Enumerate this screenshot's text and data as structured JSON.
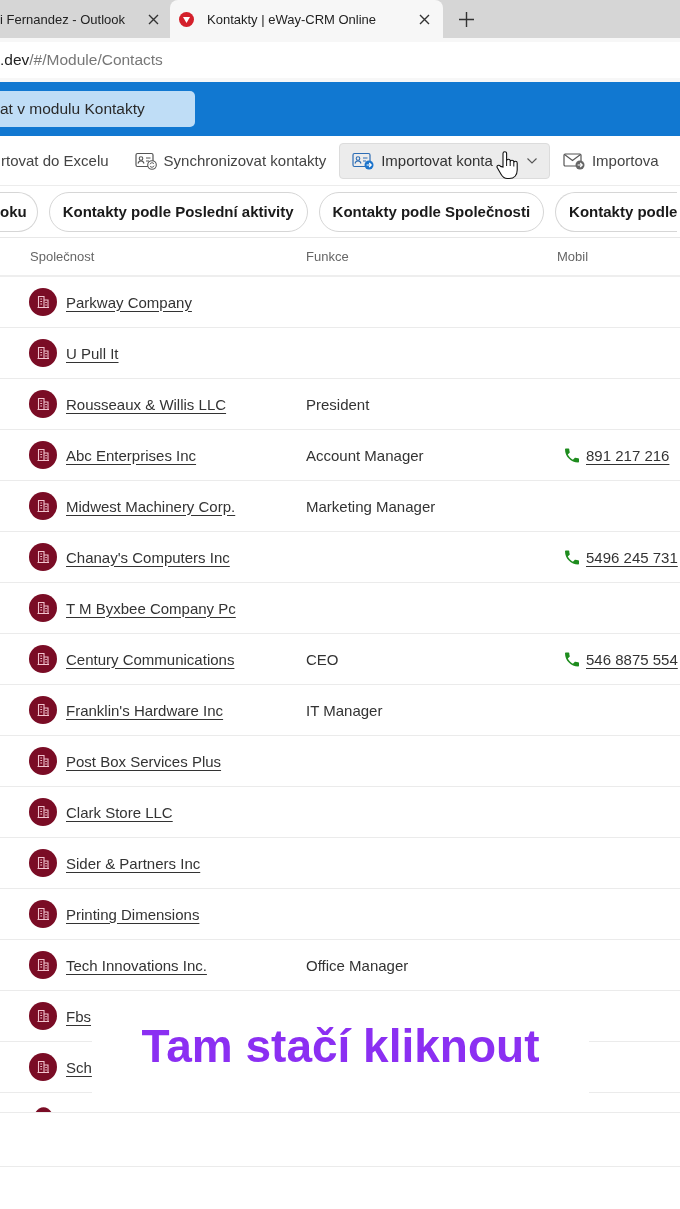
{
  "browser": {
    "tabs": [
      {
        "title": "i Fernandez - Outlook",
        "selected": false
      },
      {
        "title": "Kontakty | eWay-CRM Online",
        "selected": true
      }
    ],
    "address": {
      "host": ".dev",
      "path": "/#/Module/Contacts"
    }
  },
  "header": {
    "search": {
      "placeholder": "at v modulu Kontakty"
    }
  },
  "toolbar": [
    {
      "kind": "plain",
      "label": "rtovat do Excelu",
      "highlighted": false,
      "dropdown": false
    },
    {
      "kind": "contact-sync",
      "label": "Synchronizovat kontakty",
      "highlighted": false,
      "dropdown": false
    },
    {
      "kind": "contact-import",
      "label": "Importovat konta",
      "highlighted": true,
      "dropdown": true
    },
    {
      "kind": "mail-import",
      "label": "Importova",
      "highlighted": false,
      "dropdown": false
    }
  ],
  "filters": [
    {
      "label": "oku",
      "selected": false
    },
    {
      "label": "Kontakty podle Poslední aktivity",
      "selected": false
    },
    {
      "label": "Kontakty podle Společnosti",
      "selected": false
    },
    {
      "label": "Kontakty podle",
      "selected": false
    }
  ],
  "table": {
    "columns": [
      "Společnost",
      "Funkce",
      "Mobil"
    ],
    "rows": [
      {
        "company": "Parkway Company",
        "partial": false
      },
      {
        "company": "U Pull It",
        "partial": false
      },
      {
        "company": "Rousseaux & Willis LLC",
        "function": "President",
        "partial": false
      },
      {
        "company": "Abc Enterprises Inc",
        "function": "Account Manager",
        "mobile": "891 217 216",
        "partial": false
      },
      {
        "company": "Midwest Machinery Corp.",
        "function": "Marketing Manager",
        "partial": false
      },
      {
        "company": "Chanay's Computers Inc",
        "mobile": "5496 245 731",
        "partial": false
      },
      {
        "company": "T M Byxbee Company Pc",
        "partial": false
      },
      {
        "company": "Century Communications",
        "function": "CEO",
        "mobile": "546 8875 554",
        "partial": false
      },
      {
        "company": "Franklin's Hardware Inc",
        "function": "IT Manager",
        "partial": false
      },
      {
        "company": "Post Box Services Plus",
        "partial": false
      },
      {
        "company": "Clark Store LLC",
        "partial": false
      },
      {
        "company": "Sider & Partners Inc",
        "partial": false
      },
      {
        "company": "Printing Dimensions",
        "partial": false
      },
      {
        "company": "Tech Innovations Inc.",
        "function": "Office Manager",
        "partial": false
      },
      {
        "company": "Fbs",
        "partial": false
      },
      {
        "company": "Sch",
        "partial": false
      },
      {
        "partial": true
      }
    ]
  },
  "caption": {
    "text": "Tam stačí kliknout"
  }
}
